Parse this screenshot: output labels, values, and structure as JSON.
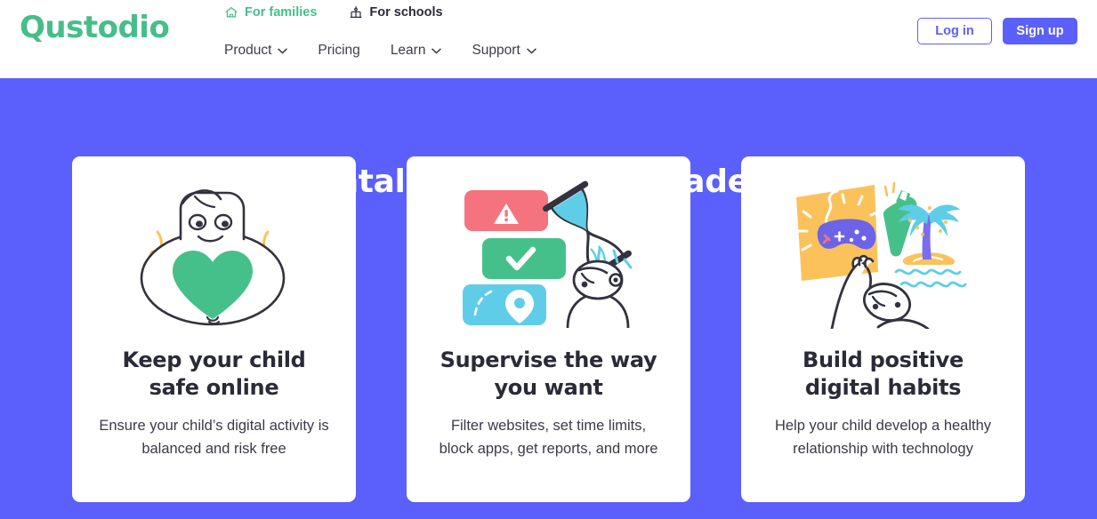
{
  "brand": {
    "logo_text": "Qustodio",
    "logo_color": "#45be8a",
    "accent_color": "#5b5ffb"
  },
  "header": {
    "top_links": [
      {
        "label": "For families",
        "icon": "home-icon",
        "active": true
      },
      {
        "label": "For schools",
        "icon": "school-icon",
        "active": false
      }
    ],
    "nav": [
      {
        "label": "Product",
        "has_dropdown": true
      },
      {
        "label": "Pricing",
        "has_dropdown": false
      },
      {
        "label": "Learn",
        "has_dropdown": true
      },
      {
        "label": "Support",
        "has_dropdown": true
      }
    ],
    "login_label": "Log in",
    "signup_label": "Sign up"
  },
  "hero": {
    "title": "Parental control tools made easy",
    "background_color": "#5b5ffb",
    "cards": [
      {
        "art": "child-hugging-heart-illustration",
        "title": "Keep your child safe online",
        "description": "Ensure your child’s digital activity is balanced and risk free"
      },
      {
        "art": "content-filter-hourglass-illustration",
        "title": "Supervise the way you want",
        "description": "Filter websites, set time limits, block apps, get reports, and more"
      },
      {
        "art": "gaming-and-play-balance-illustration",
        "title": "Build positive digital habits",
        "description": "Help your child develop a healthy relationship with technology"
      }
    ]
  },
  "palette": {
    "green": "#46c08b",
    "red": "#f4737f",
    "blue": "#5fcde8",
    "yellow": "#fbc25c",
    "purple": "#6c63e8",
    "ink": "#33333f"
  }
}
